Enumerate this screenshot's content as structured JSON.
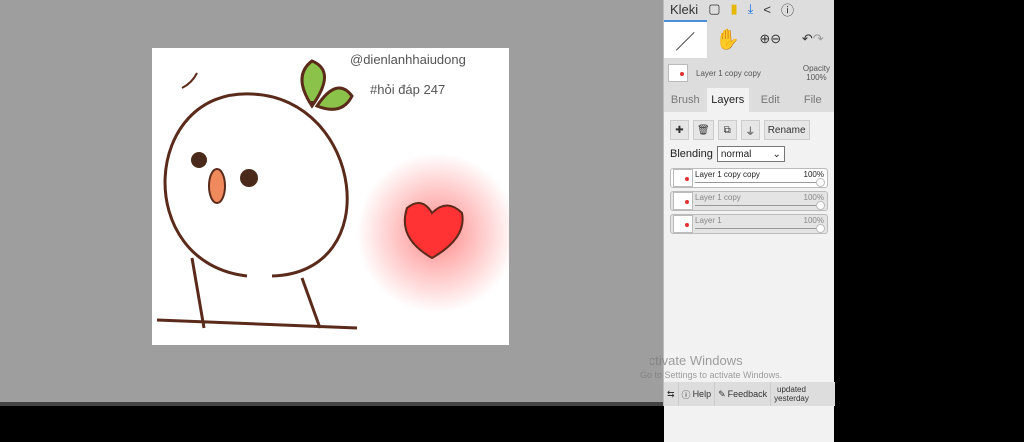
{
  "canvas": {
    "watermark_user": "@dienlanhhaiudong",
    "watermark_tag": "#hỏi đáp 247"
  },
  "app": {
    "name": "Kleki"
  },
  "layer_info": {
    "name": "Layer 1 copy copy",
    "opacity_label": "Opacity",
    "opacity_value": "100%"
  },
  "tabs": [
    "Brush",
    "Layers",
    "Edit",
    "File"
  ],
  "layer_buttons": {
    "rename": "Rename"
  },
  "blending": {
    "label": "Blending",
    "value": "normal"
  },
  "layers": [
    {
      "name": "Layer 1 copy copy",
      "opacity": "100%"
    },
    {
      "name": "Layer 1 copy",
      "opacity": "100%"
    },
    {
      "name": "Layer 1",
      "opacity": "100%"
    }
  ],
  "footer": {
    "help": "Help",
    "feedback": "Feedback",
    "updated": "updated",
    "yesterday": "yesterday"
  },
  "activation": {
    "title": "Activate Windows",
    "subtitle": "Go to Settings to activate Windows."
  }
}
